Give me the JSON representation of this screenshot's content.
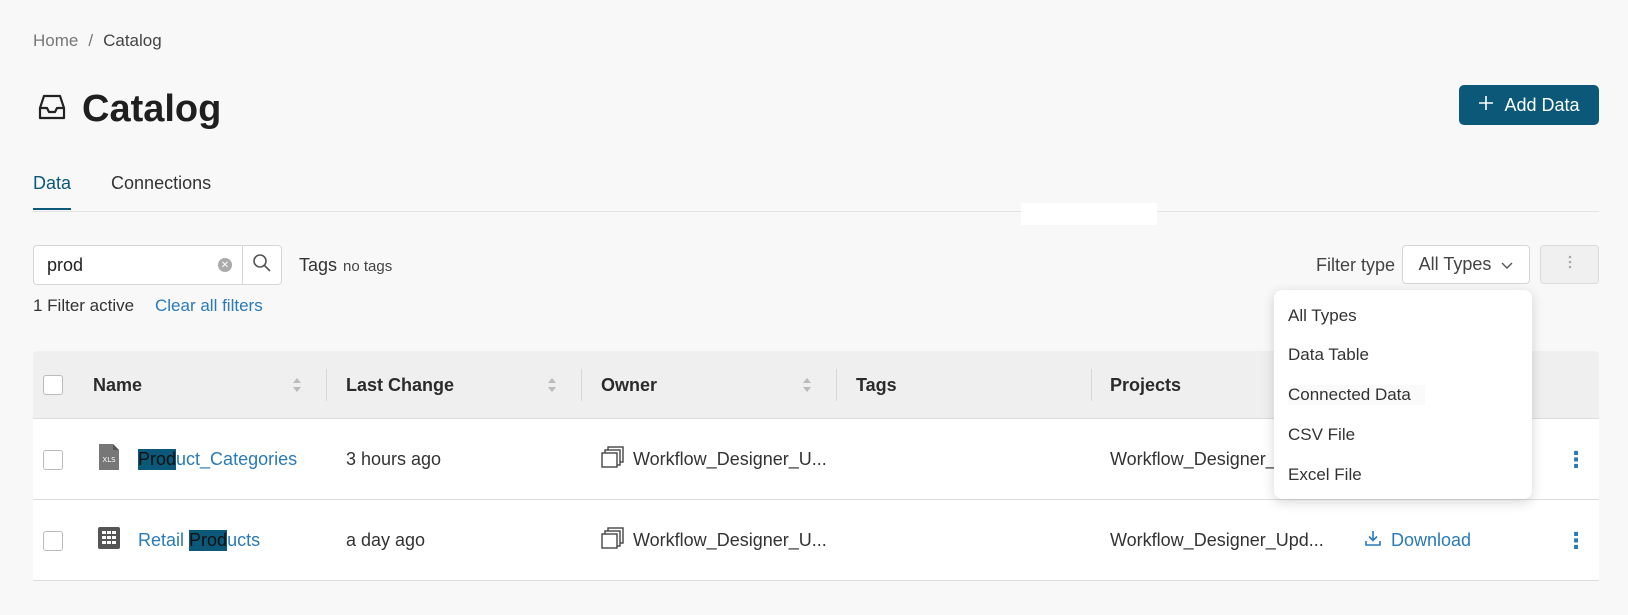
{
  "breadcrumb": {
    "home": "Home",
    "separator": "/",
    "current": "Catalog"
  },
  "page": {
    "title": "Catalog",
    "title_icon": "inbox-icon"
  },
  "actions": {
    "add_data_label": "Add Data"
  },
  "tabs": [
    {
      "label": "Data",
      "active": true
    },
    {
      "label": "Connections",
      "active": false
    }
  ],
  "search": {
    "value": "prod"
  },
  "tags": {
    "label": "Tags",
    "value": "no tags"
  },
  "filters": {
    "active_text": "1 Filter active",
    "clear_label": "Clear all filters"
  },
  "filter_type": {
    "label": "Filter type",
    "selected": "All Types",
    "options": [
      "All Types",
      "Data Table",
      "Connected Data",
      "CSV File",
      "Excel File"
    ]
  },
  "table": {
    "columns": [
      "Name",
      "Last Change",
      "Owner",
      "Tags",
      "Projects"
    ],
    "rows": [
      {
        "icon": "xls-file-icon",
        "name_highlight": "Prod",
        "name_rest": "uct_Categories",
        "last_change": "3 hours ago",
        "owner": "Workflow_Designer_U...",
        "project": "Workflow_Designer_",
        "download": ""
      },
      {
        "icon": "table-grid-icon",
        "name_prefix": "Retail ",
        "name_highlight": "Prod",
        "name_rest": "ucts",
        "last_change": "a day ago",
        "owner": "Workflow_Designer_U...",
        "project": "Workflow_Designer_Upd...",
        "download": "Download"
      }
    ]
  },
  "colors": {
    "primary": "#0b5878",
    "link": "#2a7ab8",
    "background": "#f8f8f8"
  }
}
